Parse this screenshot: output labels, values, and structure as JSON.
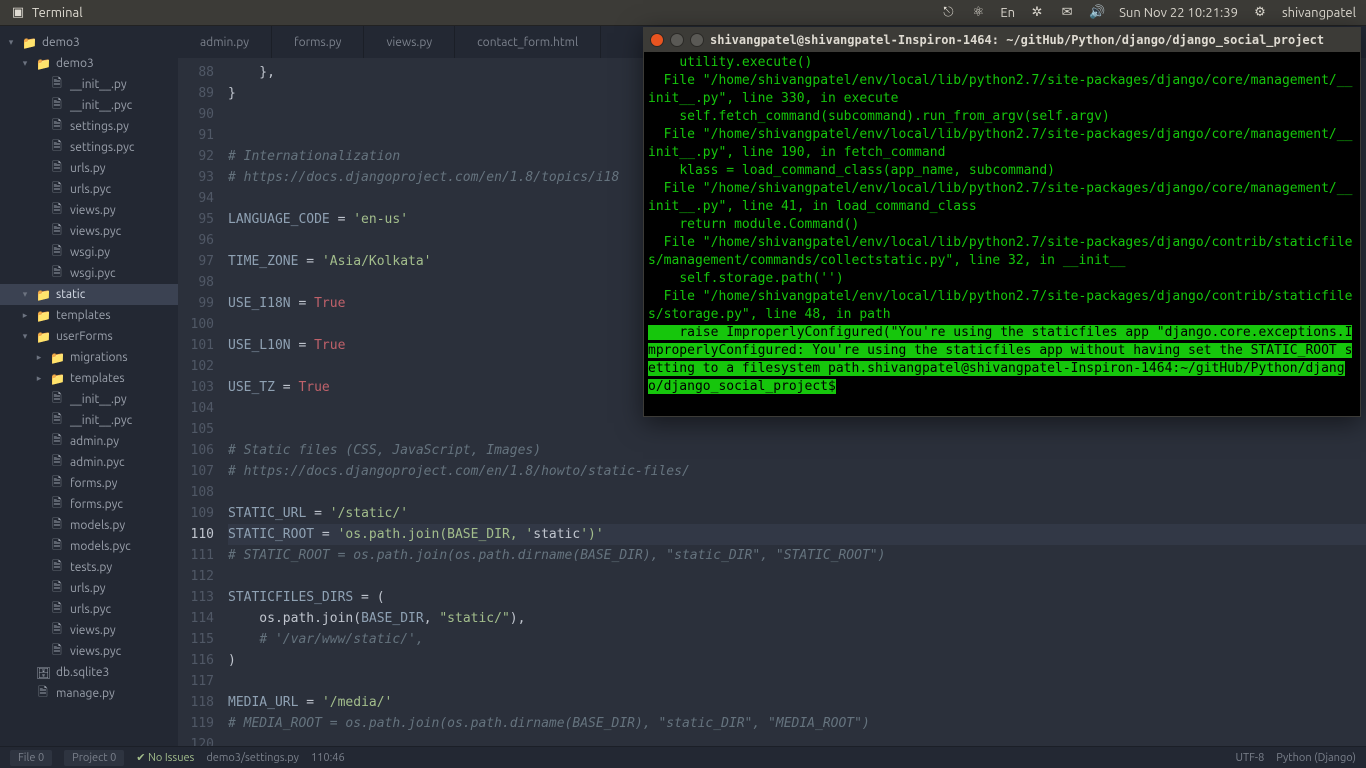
{
  "menubar": {
    "app_title": "Terminal",
    "clock": "Sun Nov 22 10:21:39",
    "user": "shivangpatel",
    "lang": "En"
  },
  "sidebar": {
    "items": [
      {
        "depth": 1,
        "tw": "open",
        "icon": "folder",
        "label": "demo3"
      },
      {
        "depth": 2,
        "tw": "open",
        "icon": "folder",
        "label": "demo3"
      },
      {
        "depth": 3,
        "tw": "none",
        "icon": "file",
        "label": "__init__.py"
      },
      {
        "depth": 3,
        "tw": "none",
        "icon": "file",
        "label": "__init__.pyc"
      },
      {
        "depth": 3,
        "tw": "none",
        "icon": "file",
        "label": "settings.py"
      },
      {
        "depth": 3,
        "tw": "none",
        "icon": "file",
        "label": "settings.pyc"
      },
      {
        "depth": 3,
        "tw": "none",
        "icon": "file",
        "label": "urls.py"
      },
      {
        "depth": 3,
        "tw": "none",
        "icon": "file",
        "label": "urls.pyc"
      },
      {
        "depth": 3,
        "tw": "none",
        "icon": "file",
        "label": "views.py"
      },
      {
        "depth": 3,
        "tw": "none",
        "icon": "file",
        "label": "views.pyc"
      },
      {
        "depth": 3,
        "tw": "none",
        "icon": "file",
        "label": "wsgi.py"
      },
      {
        "depth": 3,
        "tw": "none",
        "icon": "file",
        "label": "wsgi.pyc"
      },
      {
        "depth": 2,
        "tw": "open",
        "icon": "folder",
        "label": "static",
        "sel": true
      },
      {
        "depth": 2,
        "tw": "closed",
        "icon": "folder",
        "label": "templates"
      },
      {
        "depth": 2,
        "tw": "open",
        "icon": "folder",
        "label": "userForms"
      },
      {
        "depth": 3,
        "tw": "closed",
        "icon": "folder",
        "label": "migrations"
      },
      {
        "depth": 3,
        "tw": "closed",
        "icon": "folder",
        "label": "templates"
      },
      {
        "depth": 3,
        "tw": "none",
        "icon": "file",
        "label": "__init__.py"
      },
      {
        "depth": 3,
        "tw": "none",
        "icon": "file",
        "label": "__init__.pyc"
      },
      {
        "depth": 3,
        "tw": "none",
        "icon": "file",
        "label": "admin.py"
      },
      {
        "depth": 3,
        "tw": "none",
        "icon": "file",
        "label": "admin.pyc"
      },
      {
        "depth": 3,
        "tw": "none",
        "icon": "file",
        "label": "forms.py"
      },
      {
        "depth": 3,
        "tw": "none",
        "icon": "file",
        "label": "forms.pyc"
      },
      {
        "depth": 3,
        "tw": "none",
        "icon": "file",
        "label": "models.py"
      },
      {
        "depth": 3,
        "tw": "none",
        "icon": "file",
        "label": "models.pyc"
      },
      {
        "depth": 3,
        "tw": "none",
        "icon": "file",
        "label": "tests.py"
      },
      {
        "depth": 3,
        "tw": "none",
        "icon": "file",
        "label": "urls.py"
      },
      {
        "depth": 3,
        "tw": "none",
        "icon": "file",
        "label": "urls.pyc"
      },
      {
        "depth": 3,
        "tw": "none",
        "icon": "file",
        "label": "views.py"
      },
      {
        "depth": 3,
        "tw": "none",
        "icon": "file",
        "label": "views.pyc"
      },
      {
        "depth": 2,
        "tw": "none",
        "icon": "db",
        "label": "db.sqlite3"
      },
      {
        "depth": 2,
        "tw": "none",
        "icon": "file",
        "label": "manage.py"
      }
    ]
  },
  "tabs": [
    {
      "label": "admin.py"
    },
    {
      "label": "forms.py"
    },
    {
      "label": "views.py"
    },
    {
      "label": "contact_form.html"
    }
  ],
  "editor": {
    "first_line": 88,
    "current_line": 110,
    "lines": [
      {
        "html": "    },"
      },
      {
        "html": "}"
      },
      {
        "html": ""
      },
      {
        "html": ""
      },
      {
        "html": "<span class='tok-c'># Internationalization</span>"
      },
      {
        "html": "<span class='tok-c'># https://docs.djangoproject.com/en/1.8/topics/i18</span>"
      },
      {
        "html": ""
      },
      {
        "html": "<span class='tok-v'>LANGUAGE_CODE</span> = <span class='tok-s'>'en-us'</span>"
      },
      {
        "html": ""
      },
      {
        "html": "<span class='tok-v'>TIME_ZONE</span> = <span class='tok-s'>'Asia/Kolkata'</span>"
      },
      {
        "html": ""
      },
      {
        "html": "<span class='tok-v'>USE_I18N</span> = <span class='tok-b'>True</span>"
      },
      {
        "html": ""
      },
      {
        "html": "<span class='tok-v'>USE_L10N</span> = <span class='tok-b'>True</span>"
      },
      {
        "html": ""
      },
      {
        "html": "<span class='tok-v'>USE_TZ</span> = <span class='tok-b'>True</span>"
      },
      {
        "html": ""
      },
      {
        "html": ""
      },
      {
        "html": "<span class='tok-c'># Static files (CSS, JavaScript, Images)</span>"
      },
      {
        "html": "<span class='tok-c'># https://docs.djangoproject.com/en/1.8/howto/static-files/</span>"
      },
      {
        "html": ""
      },
      {
        "html": "<span class='tok-v'>STATIC_URL</span> = <span class='tok-s'>'/static/'</span>"
      },
      {
        "html": "<span class='tok-v'>STATIC_ROOT</span> = <span class='tok-s'>'os.path.join(BASE_DIR, '</span>static<span class='tok-s'>')'</span>"
      },
      {
        "html": "<span class='tok-c'># STATIC_ROOT = os.path.join(os.path.dirname(BASE_DIR), \"static_DIR\", \"STATIC_ROOT\")</span>"
      },
      {
        "html": ""
      },
      {
        "html": "<span class='tok-v'>STATICFILES_DIRS</span> = ("
      },
      {
        "html": "    os.path.join(<span class='tok-v'>BASE_DIR</span>, <span class='tok-s'>\"static/\"</span>),"
      },
      {
        "html": "    <span class='tok-c'># '/var/www/static/',</span>"
      },
      {
        "html": ")"
      },
      {
        "html": ""
      },
      {
        "html": "<span class='tok-v'>MEDIA_URL</span> = <span class='tok-s'>'/media/'</span>"
      },
      {
        "html": "<span class='tok-c'># MEDIA_ROOT = os.path.join(os.path.dirname(BASE_DIR), \"static_DIR\", \"MEDIA_ROOT\")</span>"
      },
      {
        "html": ""
      }
    ]
  },
  "statusbar": {
    "file_count_label": "File",
    "file_count": "0",
    "project_count_label": "Project",
    "project_count": "0",
    "issues": "No Issues",
    "path": "demo3/settings.py",
    "position": "110:46",
    "encoding": "UTF-8",
    "mode": "Python (Django)"
  },
  "terminal": {
    "title": "shivangpatel@shivangpatel-Inspiron-1464: ~/gitHub/Python/django/django_social_project",
    "lines": [
      {
        "t": "    utility.execute()"
      },
      {
        "t": "  File \"/home/shivangpatel/env/local/lib/python2.7/site-packages/django/core/management/__init__.py\", line 330, in execute"
      },
      {
        "t": "    self.fetch_command(subcommand).run_from_argv(self.argv)"
      },
      {
        "t": "  File \"/home/shivangpatel/env/local/lib/python2.7/site-packages/django/core/management/__init__.py\", line 190, in fetch_command"
      },
      {
        "t": "    klass = load_command_class(app_name, subcommand)"
      },
      {
        "t": "  File \"/home/shivangpatel/env/local/lib/python2.7/site-packages/django/core/management/__init__.py\", line 41, in load_command_class"
      },
      {
        "t": "    return module.Command()"
      },
      {
        "t": "  File \"/home/shivangpatel/env/local/lib/python2.7/site-packages/django/contrib/staticfiles/management/commands/collectstatic.py\", line 32, in __init__"
      },
      {
        "t": "    self.storage.path('')"
      },
      {
        "t": "  File \"/home/shivangpatel/env/local/lib/python2.7/site-packages/django/contrib/staticfiles/storage.py\", line 48, in path"
      },
      {
        "t": "    raise ImproperlyConfigured(\"You're using the staticfiles app \"",
        "hl": true
      },
      {
        "t": "django.core.exceptions.ImproperlyConfigured: You're using the staticfiles app without having set the STATIC_ROOT setting to a filesystem path.",
        "hl": true
      },
      {
        "t": "shivangpatel@shivangpatel-Inspiron-1464:~/gitHub/Python/django/django_social_project$",
        "hl": true
      }
    ]
  }
}
